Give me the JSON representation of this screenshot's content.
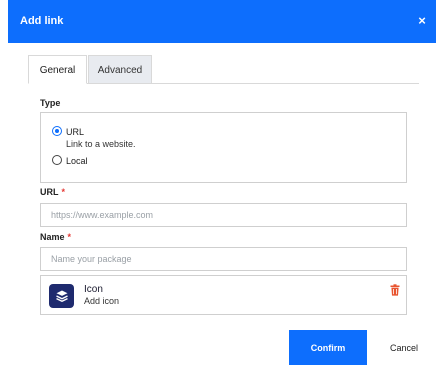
{
  "dialog": {
    "title": "Add link",
    "close_glyph": "×"
  },
  "tabs": [
    {
      "label": "General",
      "active": true
    },
    {
      "label": "Advanced",
      "active": false
    }
  ],
  "type_section": {
    "label": "Type",
    "options": [
      {
        "label": "URL",
        "description": "Link to a website.",
        "selected": true
      },
      {
        "label": "Local",
        "selected": false
      }
    ]
  },
  "url_field": {
    "label": "URL",
    "required_mark": "*",
    "value": "",
    "placeholder": "https://www.example.com"
  },
  "name_field": {
    "label": "Name",
    "required_mark": "*",
    "value": "",
    "placeholder": "Name your package"
  },
  "icon_card": {
    "title": "Icon",
    "subtitle": "Add icon",
    "icon": "stack-layers-icon",
    "delete_icon": "trash-icon"
  },
  "actions": {
    "confirm_label": "Confirm",
    "cancel_label": "Cancel"
  },
  "colors": {
    "primary": "#0d6efd",
    "required": "#e53935",
    "icon_tile": "#1e2a6e",
    "trash": "#e8542f"
  }
}
